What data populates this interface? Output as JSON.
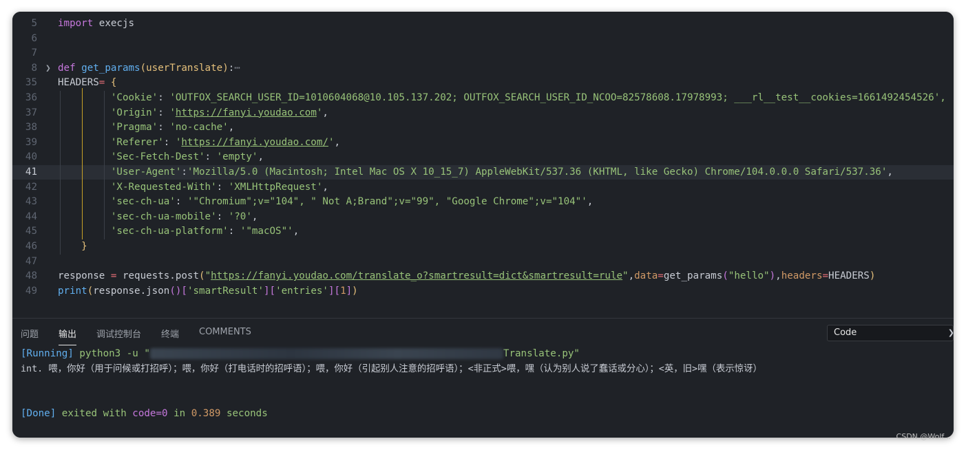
{
  "editor": {
    "lines": [
      {
        "num": "5",
        "segments": [
          {
            "c": "kw",
            "t": "import"
          },
          {
            "c": "plain",
            "t": " execjs"
          }
        ]
      },
      {
        "num": "6",
        "segments": []
      },
      {
        "num": "7",
        "segments": []
      },
      {
        "num": "8",
        "fold": true,
        "segments": [
          {
            "c": "kw",
            "t": "def"
          },
          {
            "c": "plain",
            "t": " "
          },
          {
            "c": "fn",
            "t": "get_params"
          },
          {
            "c": "br1",
            "t": "("
          },
          {
            "c": "param",
            "t": "userTranslate"
          },
          {
            "c": "br1",
            "t": ")"
          },
          {
            "c": "plain",
            "t": ":"
          },
          {
            "c": "ellip",
            "t": "⋯"
          }
        ]
      },
      {
        "num": "35",
        "segments": [
          {
            "c": "plain",
            "t": "HEADERS"
          },
          {
            "c": "op",
            "t": "="
          },
          {
            "c": "plain",
            "t": " "
          },
          {
            "c": "br1",
            "t": "{"
          }
        ]
      },
      {
        "num": "36",
        "segments": [
          {
            "c": "plain",
            "t": "         "
          },
          {
            "c": "str",
            "t": "'Cookie'"
          },
          {
            "c": "plain",
            "t": ": "
          },
          {
            "c": "str",
            "t": "'OUTFOX_SEARCH_USER_ID=1010604068@10.105.137.202; OUTFOX_SEARCH_USER_ID_NCOO=82578608.17978993; ___rl__test__cookies=1661492454526',"
          }
        ]
      },
      {
        "num": "37",
        "segments": [
          {
            "c": "plain",
            "t": "         "
          },
          {
            "c": "str",
            "t": "'Origin'"
          },
          {
            "c": "plain",
            "t": ": "
          },
          {
            "c": "str",
            "t": "'"
          },
          {
            "c": "url",
            "t": "https://fanyi.youdao.com"
          },
          {
            "c": "str",
            "t": "'"
          },
          {
            "c": "plain",
            "t": ","
          }
        ]
      },
      {
        "num": "38",
        "segments": [
          {
            "c": "plain",
            "t": "         "
          },
          {
            "c": "str",
            "t": "'Pragma'"
          },
          {
            "c": "plain",
            "t": ": "
          },
          {
            "c": "str",
            "t": "'no-cache'"
          },
          {
            "c": "plain",
            "t": ","
          }
        ]
      },
      {
        "num": "39",
        "segments": [
          {
            "c": "plain",
            "t": "         "
          },
          {
            "c": "str",
            "t": "'Referer'"
          },
          {
            "c": "plain",
            "t": ": "
          },
          {
            "c": "str",
            "t": "'"
          },
          {
            "c": "url",
            "t": "https://fanyi.youdao.com/"
          },
          {
            "c": "str",
            "t": "'"
          },
          {
            "c": "plain",
            "t": ","
          }
        ]
      },
      {
        "num": "40",
        "segments": [
          {
            "c": "plain",
            "t": "         "
          },
          {
            "c": "str",
            "t": "'Sec-Fetch-Dest'"
          },
          {
            "c": "plain",
            "t": ": "
          },
          {
            "c": "str",
            "t": "'empty'"
          },
          {
            "c": "plain",
            "t": ","
          }
        ]
      },
      {
        "num": "41",
        "current": true,
        "segments": [
          {
            "c": "plain",
            "t": "         "
          },
          {
            "c": "str",
            "t": "'User-Agent'"
          },
          {
            "c": "plain",
            "t": ":"
          },
          {
            "c": "str",
            "t": "'Mozilla/5.0 (Macintosh; Intel Mac OS X 10_15_7) AppleWebKit/537.36 (KHTML, like Gecko) Chrome/104.0.0.0 Safari/537.36'"
          },
          {
            "c": "plain",
            "t": ","
          }
        ]
      },
      {
        "num": "42",
        "segments": [
          {
            "c": "plain",
            "t": "         "
          },
          {
            "c": "str",
            "t": "'X-Requested-With'"
          },
          {
            "c": "plain",
            "t": ": "
          },
          {
            "c": "str",
            "t": "'XMLHttpRequest'"
          },
          {
            "c": "plain",
            "t": ","
          }
        ]
      },
      {
        "num": "43",
        "segments": [
          {
            "c": "plain",
            "t": "         "
          },
          {
            "c": "str",
            "t": "'sec-ch-ua'"
          },
          {
            "c": "plain",
            "t": ": "
          },
          {
            "c": "str",
            "t": "'\"Chromium\";v=\"104\", \" Not A;Brand\";v=\"99\", \"Google Chrome\";v=\"104\"'"
          },
          {
            "c": "plain",
            "t": ","
          }
        ]
      },
      {
        "num": "44",
        "segments": [
          {
            "c": "plain",
            "t": "         "
          },
          {
            "c": "str",
            "t": "'sec-ch-ua-mobile'"
          },
          {
            "c": "plain",
            "t": ": "
          },
          {
            "c": "str",
            "t": "'?0'"
          },
          {
            "c": "plain",
            "t": ","
          }
        ]
      },
      {
        "num": "45",
        "segments": [
          {
            "c": "plain",
            "t": "         "
          },
          {
            "c": "str",
            "t": "'sec-ch-ua-platform'"
          },
          {
            "c": "plain",
            "t": ": "
          },
          {
            "c": "str",
            "t": "'\"macOS\"'"
          },
          {
            "c": "plain",
            "t": ","
          }
        ]
      },
      {
        "num": "46",
        "segments": [
          {
            "c": "plain",
            "t": "    "
          },
          {
            "c": "br1",
            "t": "}"
          }
        ]
      },
      {
        "num": "47",
        "segments": []
      },
      {
        "num": "48",
        "segments": [
          {
            "c": "plain",
            "t": "response "
          },
          {
            "c": "op",
            "t": "="
          },
          {
            "c": "plain",
            "t": " requests.post"
          },
          {
            "c": "br1",
            "t": "("
          },
          {
            "c": "str",
            "t": "\""
          },
          {
            "c": "url",
            "t": "https://fanyi.youdao.com/translate_o?smartresult=dict&smartresult=rule"
          },
          {
            "c": "str",
            "t": "\""
          },
          {
            "c": "plain",
            "t": ","
          },
          {
            "c": "kwarg",
            "t": "data"
          },
          {
            "c": "op",
            "t": "="
          },
          {
            "c": "plain",
            "t": "get_params"
          },
          {
            "c": "br2",
            "t": "("
          },
          {
            "c": "str",
            "t": "\"hello\""
          },
          {
            "c": "br2",
            "t": ")"
          },
          {
            "c": "plain",
            "t": ","
          },
          {
            "c": "kwarg",
            "t": "headers"
          },
          {
            "c": "op",
            "t": "="
          },
          {
            "c": "plain",
            "t": "HEADERS"
          },
          {
            "c": "br1",
            "t": ")"
          }
        ]
      },
      {
        "num": "49",
        "segments": [
          {
            "c": "fn",
            "t": "print"
          },
          {
            "c": "br1",
            "t": "("
          },
          {
            "c": "plain",
            "t": "response.json"
          },
          {
            "c": "br2",
            "t": "()"
          },
          {
            "c": "br2",
            "t": "["
          },
          {
            "c": "str",
            "t": "'smartResult'"
          },
          {
            "c": "br2",
            "t": "]["
          },
          {
            "c": "str",
            "t": "'entries'"
          },
          {
            "c": "br2",
            "t": "]["
          },
          {
            "c": "orange",
            "t": "1"
          },
          {
            "c": "br2",
            "t": "]"
          },
          {
            "c": "br1",
            "t": ")"
          }
        ]
      }
    ]
  },
  "panel": {
    "tabs": [
      "问题",
      "输出",
      "调试控制台",
      "终端",
      "COMMENTS"
    ],
    "active_tab": "输出",
    "channel_select": "Code",
    "output": {
      "running_tag": "[Running]",
      "command": " python3 -u \"",
      "command_tail": "Translate.py\"",
      "result": "int. 喂，你好（用于问候或打招呼）；喂，你好（打电话时的招呼语）；喂，你好（引起别人注意的招呼语）；<非正式>喂，嘿（认为别人说了蠢话或分心）；<英，旧>嘿（表示惊讶）",
      "done_tag": "[Done]",
      "done_text_1": " exited with ",
      "done_code": "code=0",
      "done_text_2": " in ",
      "done_time": "0.389",
      "done_text_3": " seconds"
    }
  },
  "watermark": "CSDN @Wolf..."
}
